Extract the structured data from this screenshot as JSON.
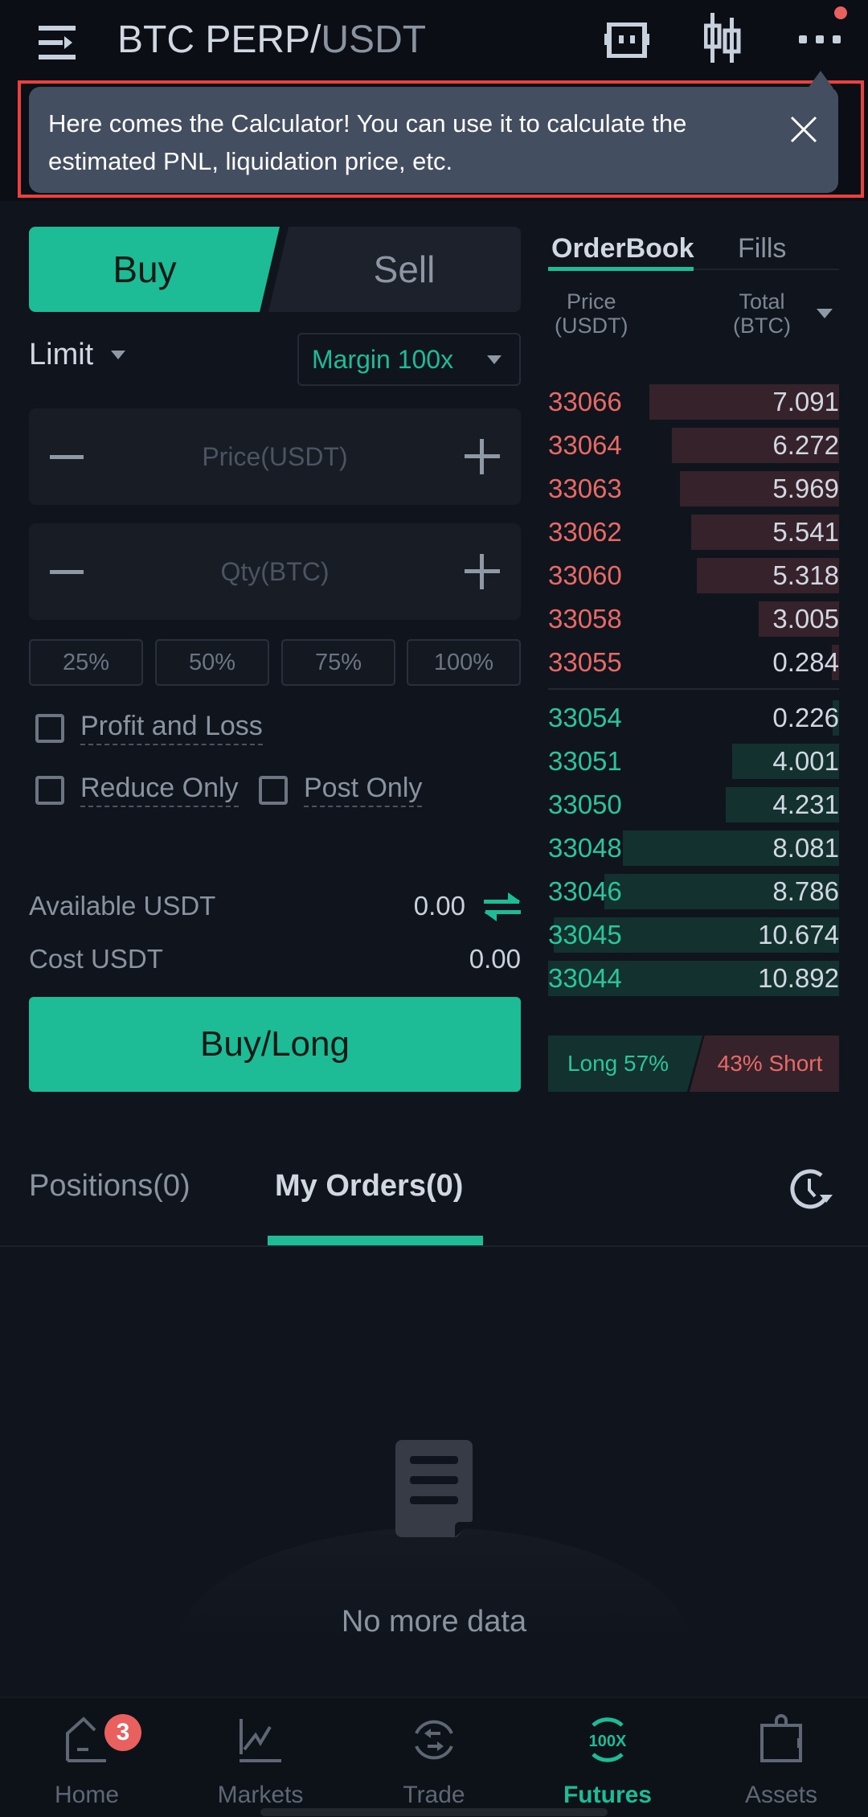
{
  "header": {
    "pair_base": "BTC PERP/",
    "pair_quote": "USDT",
    "icons": [
      "menu-icon",
      "calculator-icon",
      "candlestick-chart-icon",
      "more-icon"
    ],
    "notification_dot_color": "#e8615e"
  },
  "tooltip": {
    "text": "Here comes the Calculator! You can use it to calculate the estimated PNL, liquidation price, etc.",
    "close_icon": "close-icon"
  },
  "order_form": {
    "side_tabs": {
      "buy": "Buy",
      "sell": "Sell",
      "active": "buy"
    },
    "order_type": "Limit",
    "margin": "Margin 100x",
    "price_input": {
      "placeholder": "Price(USDT)",
      "value": ""
    },
    "qty_input": {
      "placeholder": "Qty(BTC)",
      "value": ""
    },
    "percent_buttons": [
      "25%",
      "50%",
      "75%",
      "100%"
    ],
    "checkboxes": [
      {
        "label": "Profit and Loss",
        "checked": false
      },
      {
        "label": "Reduce Only",
        "checked": false
      },
      {
        "label": "Post Only",
        "checked": false
      }
    ],
    "available_label": "Available USDT",
    "available_value": "0.00",
    "cost_label": "Cost USDT",
    "cost_value": "0.00",
    "submit_label": "Buy/Long"
  },
  "orderbook": {
    "tabs": [
      "OrderBook",
      "Fills"
    ],
    "active_tab": "OrderBook",
    "col_price": [
      "Price",
      "(USDT)"
    ],
    "col_total": [
      "Total",
      "(BTC)"
    ],
    "max_total": 10.892,
    "asks": [
      {
        "price": "33066",
        "total": "7.091"
      },
      {
        "price": "33064",
        "total": "6.272"
      },
      {
        "price": "33063",
        "total": "5.969"
      },
      {
        "price": "33062",
        "total": "5.541"
      },
      {
        "price": "33060",
        "total": "5.318"
      },
      {
        "price": "33058",
        "total": "3.005"
      },
      {
        "price": "33055",
        "total": "0.284"
      }
    ],
    "bids": [
      {
        "price": "33054",
        "total": "0.226"
      },
      {
        "price": "33051",
        "total": "4.001"
      },
      {
        "price": "33050",
        "total": "4.231"
      },
      {
        "price": "33048",
        "total": "8.081"
      },
      {
        "price": "33046",
        "total": "8.786"
      },
      {
        "price": "33045",
        "total": "10.674"
      },
      {
        "price": "33044",
        "total": "10.892"
      }
    ],
    "long_label": "Long 57%",
    "short_label": "43% Short",
    "long_percent": 57,
    "short_percent": 43
  },
  "orders": {
    "tabs": [
      "Positions(0)",
      "My Orders(0)"
    ],
    "active_tab": "My Orders(0)",
    "empty_text": "No more data"
  },
  "bottom_nav": {
    "items": [
      {
        "label": "Home",
        "icon": "home-icon",
        "badge": "3"
      },
      {
        "label": "Markets",
        "icon": "markets-chart-icon"
      },
      {
        "label": "Trade",
        "icon": "trade-exchange-icon"
      },
      {
        "label": "Futures",
        "icon": "futures-100x-icon",
        "active": true
      },
      {
        "label": "Assets",
        "icon": "wallet-icon"
      }
    ]
  },
  "colors": {
    "accent": "#1dbc96",
    "ask": "#e86a66",
    "bid": "#2bc59d",
    "background": "#10141c"
  }
}
